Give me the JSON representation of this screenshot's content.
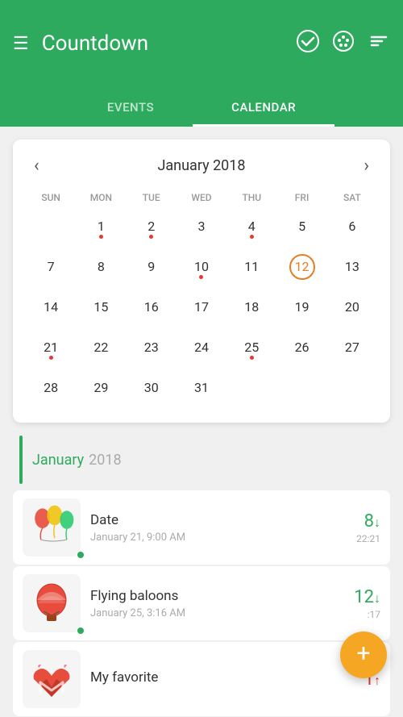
{
  "header": {
    "title": "Countdown",
    "hamburger_label": "☰",
    "check_icon": "✓",
    "palette_icon": "🎨",
    "sort_icon": "≡"
  },
  "tabs": [
    {
      "label": "EVENTS",
      "active": false
    },
    {
      "label": "CALENDAR",
      "active": true
    }
  ],
  "calendar": {
    "title": "January 2018",
    "day_labels": [
      "SUN",
      "MON",
      "TUE",
      "WED",
      "THU",
      "FRI",
      "SAT"
    ],
    "weeks": [
      [
        {
          "num": "",
          "dot": false,
          "today": false
        },
        {
          "num": "1",
          "dot": true,
          "today": false
        },
        {
          "num": "2",
          "dot": true,
          "today": false
        },
        {
          "num": "3",
          "dot": false,
          "today": false
        },
        {
          "num": "4",
          "dot": true,
          "today": false
        },
        {
          "num": "5",
          "dot": false,
          "today": false
        },
        {
          "num": "6",
          "dot": false,
          "today": false
        }
      ],
      [
        {
          "num": "7",
          "dot": false,
          "today": false
        },
        {
          "num": "8",
          "dot": false,
          "today": false
        },
        {
          "num": "9",
          "dot": false,
          "today": false
        },
        {
          "num": "10",
          "dot": true,
          "today": false
        },
        {
          "num": "11",
          "dot": false,
          "today": false
        },
        {
          "num": "12",
          "dot": false,
          "today": true
        },
        {
          "num": "13",
          "dot": false,
          "today": false
        }
      ],
      [
        {
          "num": "14",
          "dot": false,
          "today": false
        },
        {
          "num": "15",
          "dot": false,
          "today": false
        },
        {
          "num": "16",
          "dot": false,
          "today": false
        },
        {
          "num": "17",
          "dot": false,
          "today": false
        },
        {
          "num": "18",
          "dot": false,
          "today": false
        },
        {
          "num": "19",
          "dot": false,
          "today": false
        },
        {
          "num": "20",
          "dot": false,
          "today": false
        }
      ],
      [
        {
          "num": "21",
          "dot": true,
          "today": false
        },
        {
          "num": "22",
          "dot": false,
          "today": false
        },
        {
          "num": "23",
          "dot": false,
          "today": false
        },
        {
          "num": "24",
          "dot": false,
          "today": false
        },
        {
          "num": "25",
          "dot": true,
          "today": false
        },
        {
          "num": "26",
          "dot": false,
          "today": false
        },
        {
          "num": "27",
          "dot": false,
          "today": false
        }
      ],
      [
        {
          "num": "28",
          "dot": false,
          "today": false
        },
        {
          "num": "29",
          "dot": false,
          "today": false
        },
        {
          "num": "30",
          "dot": false,
          "today": false
        },
        {
          "num": "31",
          "dot": false,
          "today": false
        },
        {
          "num": "",
          "dot": false,
          "today": false
        },
        {
          "num": "",
          "dot": false,
          "today": false
        },
        {
          "num": "",
          "dot": false,
          "today": false
        }
      ]
    ]
  },
  "events_section": {
    "month": "January",
    "year": "2018",
    "events": [
      {
        "name": "Date",
        "date": "January 21, 9:00 AM",
        "count": "8",
        "count_dir": "↓",
        "sub_time": "22:21",
        "has_dot": true,
        "thumb_type": "balloons"
      },
      {
        "name": "Flying baloons",
        "date": "January 25, 3:16 AM",
        "count": "12",
        "count_dir": "↓",
        "sub_time": ":17",
        "has_dot": true,
        "thumb_type": "hotair"
      },
      {
        "name": "My favorite",
        "date": "",
        "count": "1",
        "count_dir": "↑",
        "sub_time": "",
        "has_dot": false,
        "thumb_type": "heart"
      }
    ]
  },
  "fab": {
    "label": "+"
  }
}
